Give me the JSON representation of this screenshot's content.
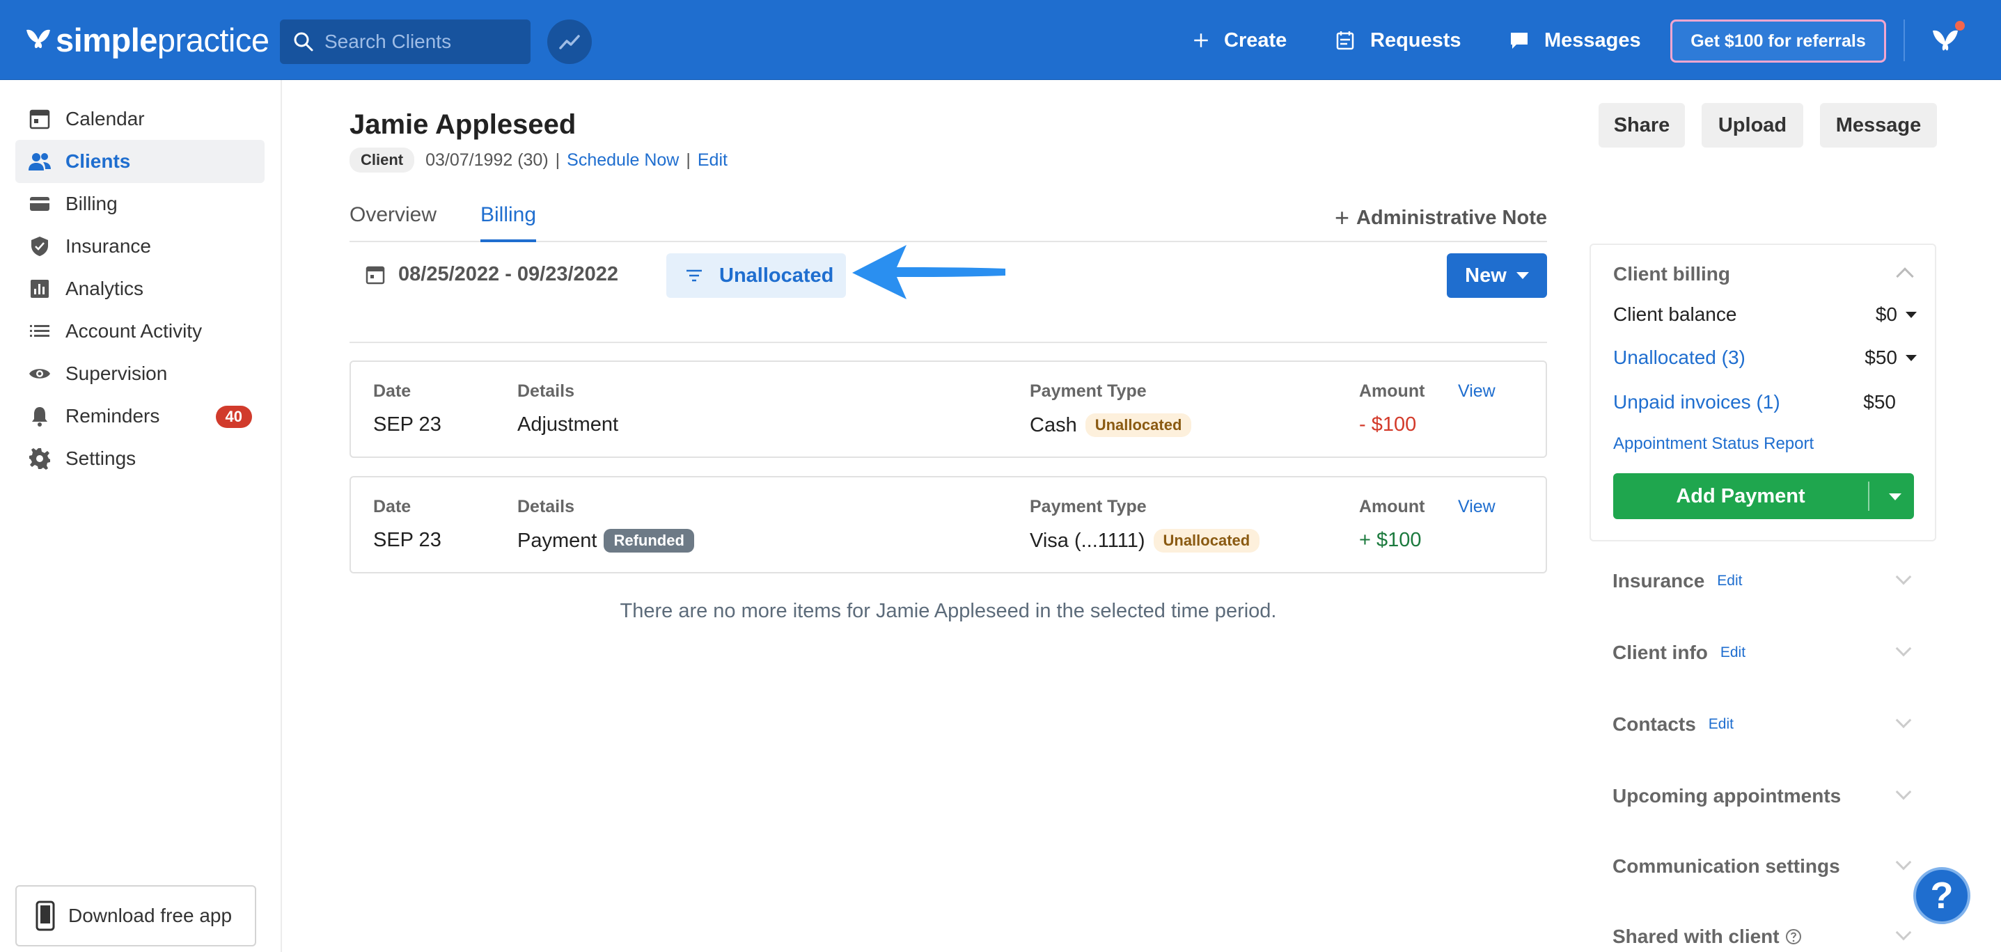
{
  "topbar": {
    "logo_bold": "simple",
    "logo_light": "practice",
    "search_placeholder": "Search Clients",
    "create_label": "Create",
    "requests_label": "Requests",
    "messages_label": "Messages",
    "referral_label": "Get $100 for referrals",
    "brand_color": "#1f6ecf"
  },
  "sidebar": {
    "items": [
      {
        "label": "Calendar",
        "icon": "calendar-icon"
      },
      {
        "label": "Clients",
        "icon": "clients-icon",
        "active": true
      },
      {
        "label": "Billing",
        "icon": "billing-card-icon"
      },
      {
        "label": "Insurance",
        "icon": "shield-icon"
      },
      {
        "label": "Analytics",
        "icon": "bar-chart-icon"
      },
      {
        "label": "Account Activity",
        "icon": "list-icon"
      },
      {
        "label": "Supervision",
        "icon": "eye-icon"
      },
      {
        "label": "Reminders",
        "icon": "bell-icon",
        "badge": "40"
      },
      {
        "label": "Settings",
        "icon": "gear-icon"
      }
    ],
    "download_label": "Download free app"
  },
  "client": {
    "name": "Jamie Appleseed",
    "chip": "Client",
    "dob": "03/07/1992 (30)",
    "sep": "|",
    "schedule_link": "Schedule Now",
    "edit_link": "Edit"
  },
  "header_buttons": {
    "share": "Share",
    "upload": "Upload",
    "message": "Message"
  },
  "tabs": {
    "overview": "Overview",
    "billing": "Billing",
    "admin_note": "Administrative Note",
    "admin_plus": "+"
  },
  "filters": {
    "date_range": "08/25/2022 - 09/23/2022",
    "filter_label": "Unallocated",
    "new_label": "New"
  },
  "table": {
    "col_date": "Date",
    "col_details": "Details",
    "col_payment_type": "Payment Type",
    "col_amount": "Amount",
    "view_label": "View",
    "rows": [
      {
        "date": "SEP 23",
        "details": "Adjustment",
        "details_badge": "",
        "payment_type": "Cash",
        "payment_badge": "Unallocated",
        "amount": "- $100"
      },
      {
        "date": "SEP 23",
        "details": "Payment",
        "details_badge": "Refunded",
        "payment_type": "Visa (...1111)",
        "payment_badge": "Unallocated",
        "amount": "+ $100"
      }
    ],
    "empty_message": "There are no more items for Jamie Appleseed in the selected time period."
  },
  "client_billing": {
    "title": "Client billing",
    "balance_label": "Client balance",
    "balance_value": "$0",
    "unallocated_label": "Unallocated (3)",
    "unallocated_value": "$50",
    "unpaid_label": "Unpaid invoices (1)",
    "unpaid_value": "$50",
    "status_report": "Appointment Status Report",
    "add_payment": "Add Payment"
  },
  "sections": [
    {
      "label": "Insurance",
      "edit": "Edit"
    },
    {
      "label": "Client info",
      "edit": "Edit"
    },
    {
      "label": "Contacts",
      "edit": "Edit"
    },
    {
      "label": "Upcoming appointments",
      "edit": ""
    },
    {
      "label": "Communication settings",
      "edit": ""
    },
    {
      "label": "Shared with client",
      "edit": ""
    }
  ],
  "help_label": "?"
}
